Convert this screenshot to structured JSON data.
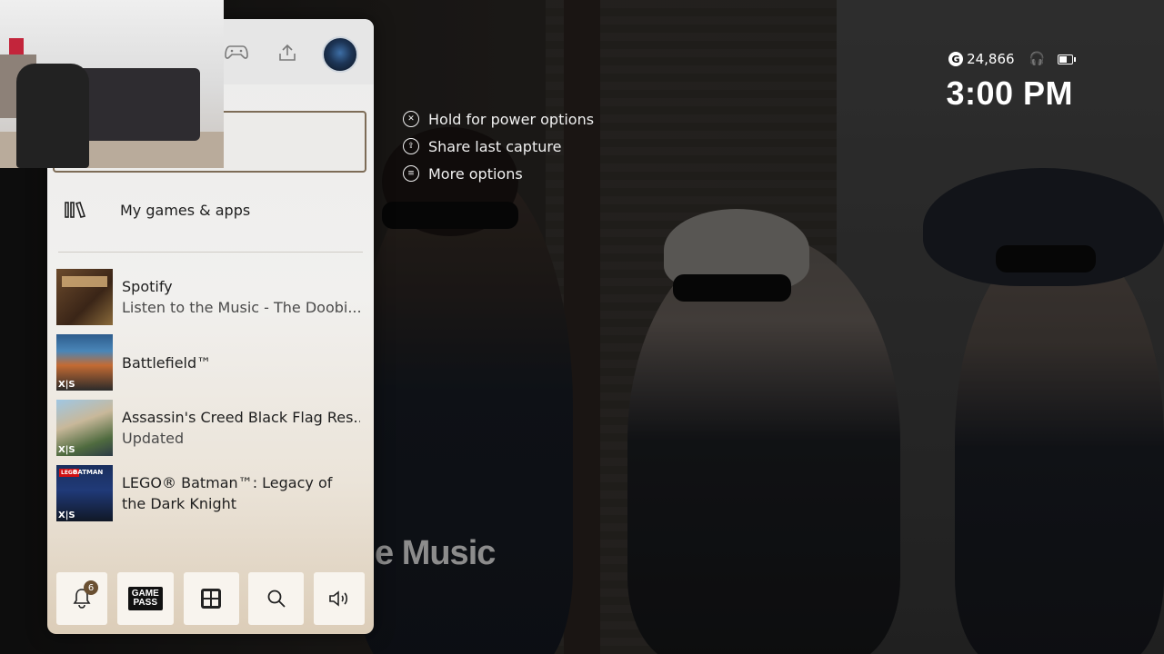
{
  "hints": [
    {
      "icon": "xbox-logo-icon",
      "label": "Hold for power options"
    },
    {
      "icon": "share-icon",
      "label": "Share last capture"
    },
    {
      "icon": "menu-icon",
      "label": "More options"
    }
  ],
  "status": {
    "gamerscore_symbol": "G",
    "gamerscore": "24,866",
    "time": "3:00 PM"
  },
  "background_text": "e Music",
  "guide": {
    "top_icons": [
      "controller-icon",
      "upload-share-icon",
      "profile-avatar"
    ],
    "menu": {
      "label": "My games & apps",
      "icon": "library-icon"
    },
    "recent": [
      {
        "title": "Spotify",
        "subtitle": "Listen to the Music - The Doobi...",
        "badge": ""
      },
      {
        "title": "Battlefield™",
        "subtitle": "",
        "badge": "X|S"
      },
      {
        "title": "Assassin's Creed Black Flag Res...",
        "subtitle": "Updated",
        "badge": "X|S"
      },
      {
        "title": "LEGO® Batman™: Legacy of the Dark Knight",
        "subtitle": "",
        "badge": "X|S"
      }
    ],
    "bottom_bar": {
      "notifications_count": "6",
      "game_pass_line1": "GAME",
      "game_pass_line2": "PASS"
    }
  }
}
